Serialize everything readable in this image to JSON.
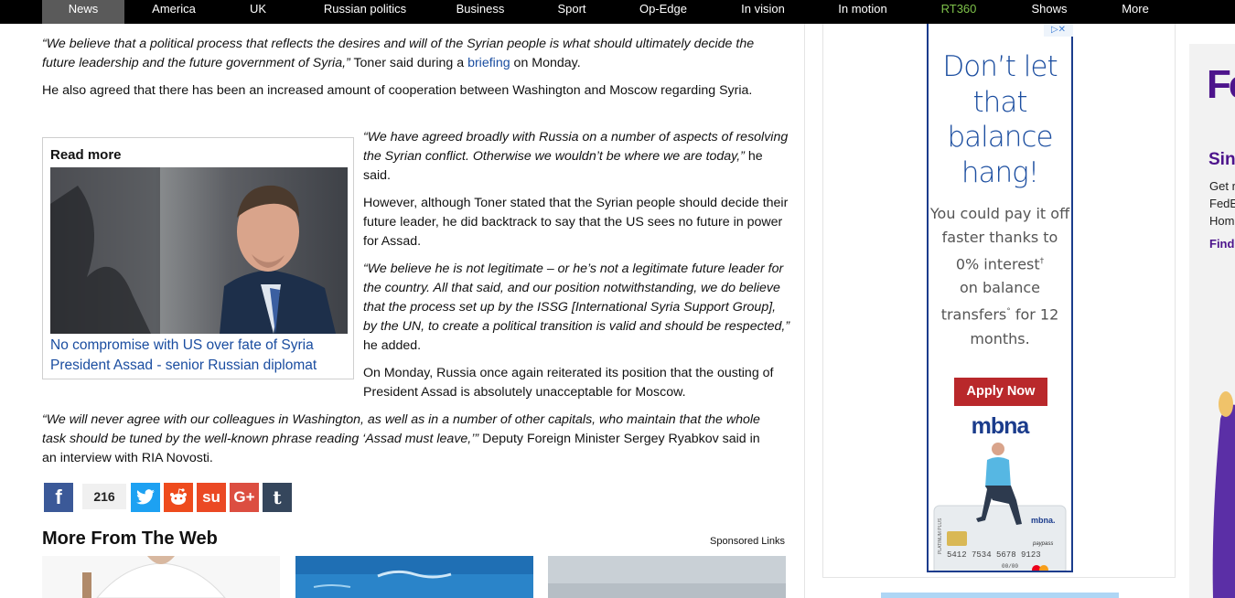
{
  "nav": {
    "items": [
      {
        "label": "News",
        "active": true
      },
      {
        "label": "America"
      },
      {
        "label": "UK"
      },
      {
        "label": "Russian politics"
      },
      {
        "label": "Business"
      },
      {
        "label": "Sport"
      },
      {
        "label": "Op-Edge"
      },
      {
        "label": "In vision"
      },
      {
        "label": "In motion"
      },
      {
        "label": "RT360"
      },
      {
        "label": "Shows"
      },
      {
        "label": "More"
      }
    ]
  },
  "article": {
    "p1_quote": "“We believe that a political process that reflects the desires and will of the Syrian people is what should ultimately decide the future leadership and the future government of Syria,”",
    "p1_mid": " Toner said during a ",
    "p1_link": "briefing",
    "p1_end": " on Monday.",
    "p2": "He also agreed that there has been an increased amount of cooperation between Washington and Moscow regarding Syria.",
    "p3_quote": "“We have agreed broadly with Russia on a number of aspects of resolving the Syrian conflict. Otherwise we wouldn’t be where we are today,”",
    "p3_end": " he said.",
    "p4": "However, although Toner stated that the Syrian people should decide their future leader, he did backtrack to say that the US sees no future in power for Assad.",
    "p5_quote": "“We believe he is not legitimate – or he’s not a legitimate future leader for the country. All that said, and our position notwithstanding, we do believe that the process set up by the ISSG [International Syria Support Group], by the UN, to create a political transition is valid and should be respected,”",
    "p5_end": " he added.",
    "p6": "On Monday, Russia once again reiterated its position that the ousting of President Assad is absolutely unacceptable for Moscow.",
    "p7_quote": "“We will never agree with our colleagues in Washington, as well as in a number of other capitals, who maintain that the whole task should be tuned by the well-known phrase reading ‘Assad must leave,’”",
    "p7_end": " Deputy Foreign Minister Sergey Ryabkov said in an interview with RIA Novosti."
  },
  "read_more": {
    "title": "Read more",
    "caption": "No compromise with US over fate of Syria President Assad - senior Russian diplomat"
  },
  "share": {
    "count": "216",
    "buttons": [
      "facebook-icon",
      "twitter-icon",
      "reddit-icon",
      "stumbleupon-icon",
      "googleplus-icon",
      "tumblr-icon"
    ],
    "colors": {
      "facebook": "#3b5998",
      "twitter": "#1da1f2",
      "reddit": "#ee4b1d",
      "stumbleupon": "#eb4924",
      "googleplus": "#dc4e41",
      "tumblr": "#35465c"
    }
  },
  "more_from_web": {
    "title": "More From The Web",
    "sponsored": "Sponsored Links"
  },
  "ad": {
    "headline": "Don’t let that balance hang!",
    "body_1": "You could pay it off faster thanks to 0% interest",
    "body_1_sup": "†",
    "body_2": "on balance transfers",
    "body_2_sup": "°",
    "body_3": "for 12 months.",
    "button": "Apply Now",
    "brand": "mbna",
    "card_brand": "mbna.",
    "card_number": "5412 7534 5678 9123",
    "card_expiry": "00/00",
    "card_label": "PLATINUM PLUS",
    "card_paypass": "paypass",
    "colors": {
      "brand": "#1b3c8c",
      "button": "#b9282b"
    }
  },
  "side_ad": {
    "logo": "Fe",
    "heading": "Sin",
    "text_lines": [
      "Get r",
      "FedE",
      "Hom"
    ],
    "link": "Find"
  }
}
